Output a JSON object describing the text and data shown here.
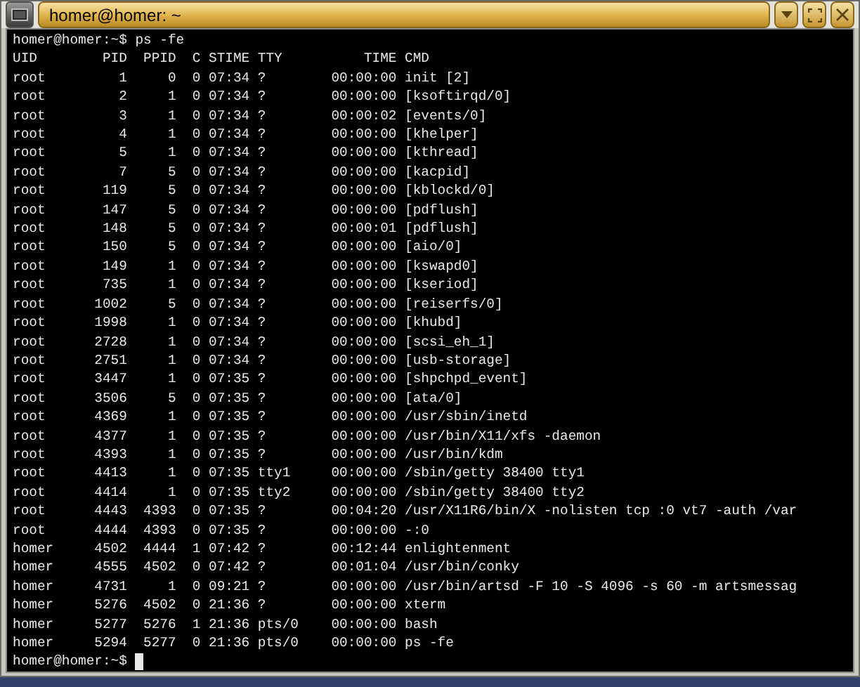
{
  "window": {
    "title": "homer@homer: ~"
  },
  "terminal": {
    "lines": [
      "homer@homer:~$ ps -fe",
      "UID        PID  PPID  C STIME TTY          TIME CMD",
      "root         1     0  0 07:34 ?        00:00:00 init [2]",
      "root         2     1  0 07:34 ?        00:00:00 [ksoftirqd/0]",
      "root         3     1  0 07:34 ?        00:00:02 [events/0]",
      "root         4     1  0 07:34 ?        00:00:00 [khelper]",
      "root         5     1  0 07:34 ?        00:00:00 [kthread]",
      "root         7     5  0 07:34 ?        00:00:00 [kacpid]",
      "root       119     5  0 07:34 ?        00:00:00 [kblockd/0]",
      "root       147     5  0 07:34 ?        00:00:00 [pdflush]",
      "root       148     5  0 07:34 ?        00:00:01 [pdflush]",
      "root       150     5  0 07:34 ?        00:00:00 [aio/0]",
      "root       149     1  0 07:34 ?        00:00:00 [kswapd0]",
      "root       735     1  0 07:34 ?        00:00:00 [kseriod]",
      "root      1002     5  0 07:34 ?        00:00:00 [reiserfs/0]",
      "root      1998     1  0 07:34 ?        00:00:00 [khubd]",
      "root      2728     1  0 07:34 ?        00:00:00 [scsi_eh_1]",
      "root      2751     1  0 07:34 ?        00:00:00 [usb-storage]",
      "root      3447     1  0 07:35 ?        00:00:00 [shpchpd_event]",
      "root      3506     5  0 07:35 ?        00:00:00 [ata/0]",
      "root      4369     1  0 07:35 ?        00:00:00 /usr/sbin/inetd",
      "root      4377     1  0 07:35 ?        00:00:00 /usr/bin/X11/xfs -daemon",
      "root      4393     1  0 07:35 ?        00:00:00 /usr/bin/kdm",
      "root      4413     1  0 07:35 tty1     00:00:00 /sbin/getty 38400 tty1",
      "root      4414     1  0 07:35 tty2     00:00:00 /sbin/getty 38400 tty2",
      "root      4443  4393  0 07:35 ?        00:04:20 /usr/X11R6/bin/X -nolisten tcp :0 vt7 -auth /var",
      "root      4444  4393  0 07:35 ?        00:00:00 -:0",
      "homer     4502  4444  1 07:42 ?        00:12:44 enlightenment",
      "homer     4555  4502  0 07:42 ?        00:01:04 /usr/bin/conky",
      "homer     4731     1  0 09:21 ?        00:00:00 /usr/bin/artsd -F 10 -S 4096 -s 60 -m artsmessag",
      "homer     5276  4502  0 21:36 ?        00:00:00 xterm",
      "homer     5277  5276  1 21:36 pts/0    00:00:00 bash",
      "homer     5294  5277  0 21:36 pts/0    00:00:00 ps -fe"
    ],
    "prompt": "homer@homer:~$ ",
    "cursor": true
  }
}
